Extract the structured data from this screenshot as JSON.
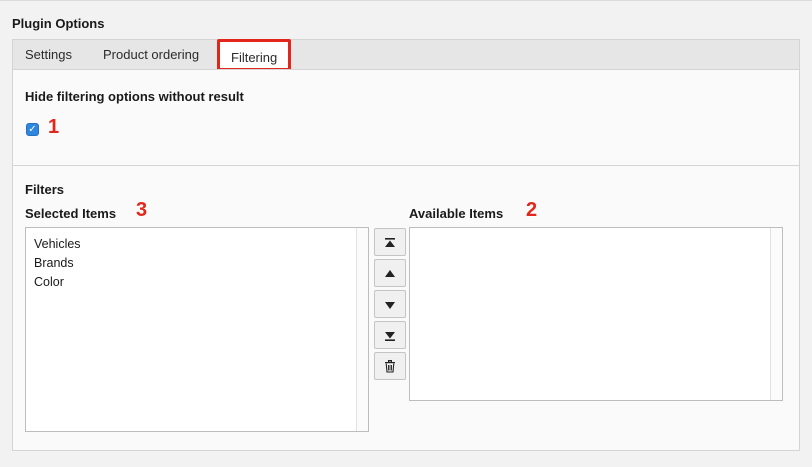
{
  "section_title": "Plugin Options",
  "tabs": [
    {
      "label": "Settings"
    },
    {
      "label": "Product ordering"
    },
    {
      "label": "Filtering"
    }
  ],
  "filtering": {
    "hide_label": "Hide filtering options without result",
    "hide_checked": true,
    "filters_label": "Filters",
    "selected_label": "Selected Items",
    "available_label": "Available Items",
    "selected_items": [
      "Vehicles",
      "Brands",
      "Color"
    ],
    "available_items": []
  },
  "annotations": [
    "1",
    "2",
    "3"
  ],
  "colors": {
    "highlight": "#e3261c",
    "checkbox": "#2e86de"
  },
  "icons": {
    "move_top": "move-to-top-icon",
    "move_up": "move-up-icon",
    "move_down": "move-down-icon",
    "move_bottom": "move-to-bottom-icon",
    "remove": "trash-icon"
  }
}
